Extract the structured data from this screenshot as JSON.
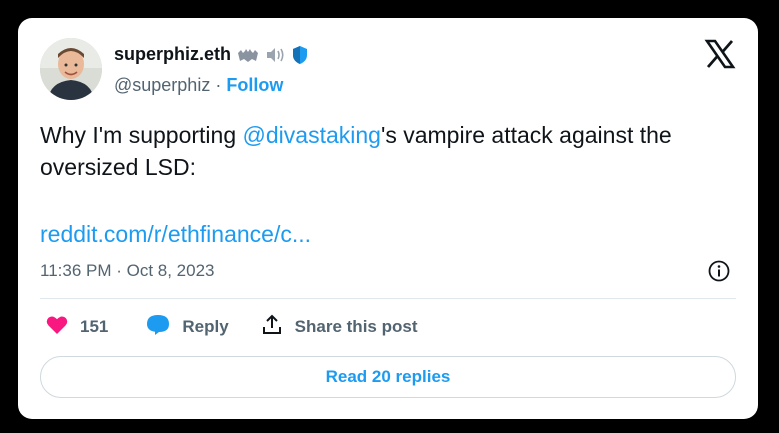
{
  "author": {
    "display_name": "superphiz.eth",
    "handle": "@superphiz",
    "separator": "·",
    "follow_label": "Follow"
  },
  "tweet": {
    "text_before": "Why I'm supporting ",
    "mention": "@divastaking",
    "text_after": "'s vampire attack against the oversized LSD:",
    "link": "reddit.com/r/ethfinance/c..."
  },
  "meta": {
    "timestamp": "11:36 PM · Oct 8, 2023"
  },
  "actions": {
    "like_count": "151",
    "reply_label": "Reply",
    "share_label": "Share this post"
  },
  "read_replies_label": "Read 20 replies",
  "colors": {
    "accent": "#1d9bf0",
    "heart": "#f91880",
    "text": "#0f1419",
    "muted": "#536471"
  },
  "icons": [
    "x-logo-icon",
    "info-icon",
    "heart-icon",
    "reply-bubble-icon",
    "share-icon",
    "verified-shield-icon",
    "bat-emoji-icon",
    "speaker-emoji-icon"
  ]
}
